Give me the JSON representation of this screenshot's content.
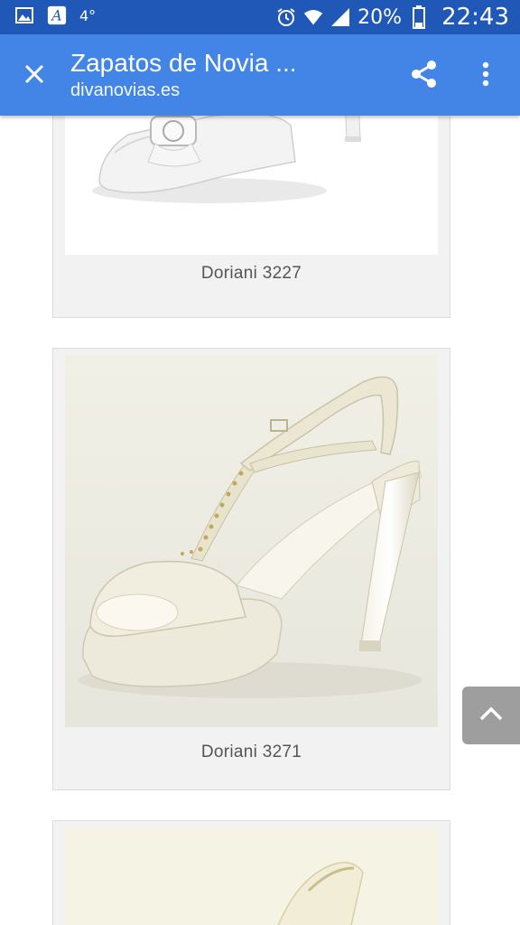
{
  "status_bar": {
    "temperature": "4°",
    "battery": "20%",
    "time": "22:43",
    "icons": [
      "gallery-icon",
      "dictionary-icon",
      "alarm-icon",
      "wifi-icon",
      "signal-icon",
      "battery-icon"
    ]
  },
  "app_bar": {
    "title": "Zapatos de Novia ...",
    "subtitle": "divanovias.es",
    "icons": [
      "close-icon",
      "share-icon",
      "more-vert-icon"
    ]
  },
  "products": [
    {
      "caption": "Doriani 3227"
    },
    {
      "caption": "Doriani 3271"
    }
  ],
  "colors": {
    "status_bar": "#1f58b6",
    "app_bar": "#4285e7",
    "card_bg": "#f2f2f2",
    "scroll_button": "#9e9e9e"
  }
}
